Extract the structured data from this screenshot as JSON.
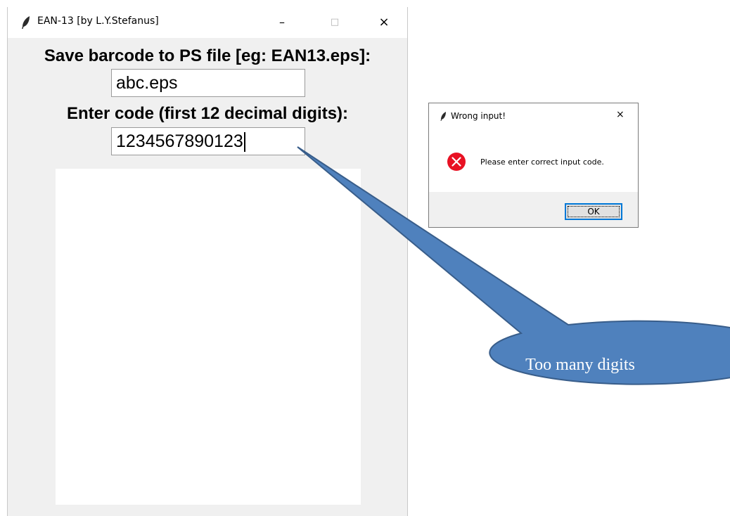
{
  "main_window": {
    "title": "EAN-13 [by L.Y.Stefanus]",
    "minimize_symbol": "–",
    "maximize_symbol": "□",
    "close_symbol": "×",
    "filename_label": "Save barcode to PS file [eg: EAN13.eps]:",
    "filename_value": "abc.eps",
    "code_label": "Enter code (first 12 decimal digits):",
    "code_value": "1234567890123"
  },
  "callout": {
    "text": "Too many digits",
    "fill_color": "#4f81bd",
    "stroke_color": "#385d8a"
  },
  "dialog": {
    "title": "Wrong input!",
    "close_symbol": "×",
    "message": "Please enter correct input code.",
    "ok_label": "OK",
    "icon": "error-icon",
    "icon_color": "#e81123"
  }
}
